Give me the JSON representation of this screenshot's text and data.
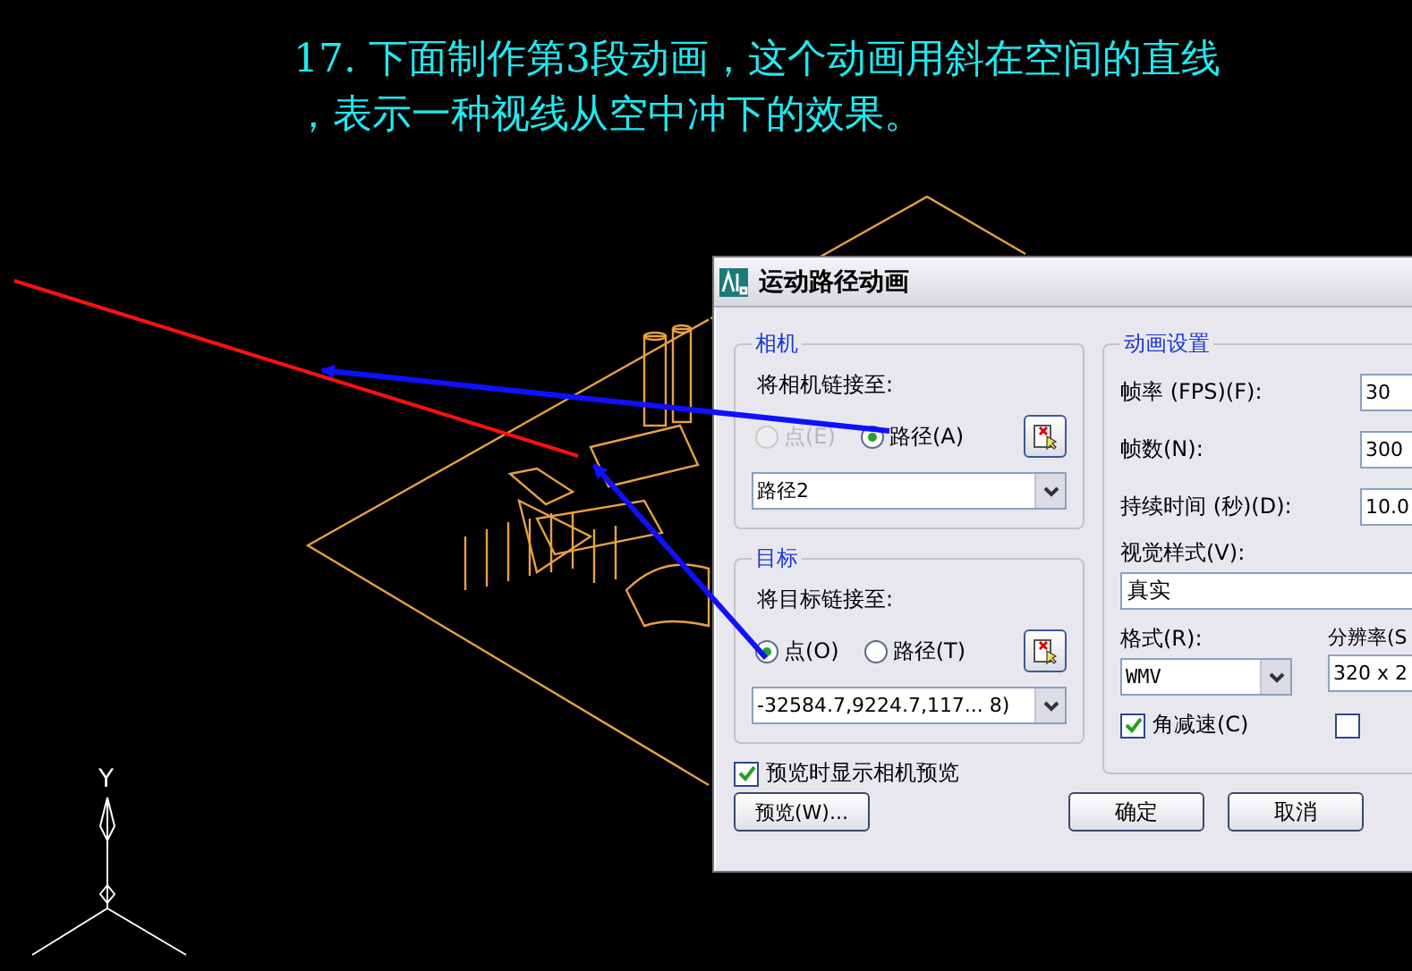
{
  "caption": {
    "lines": [
      "17. 下面制作第3段动画，这个动画用斜在空间的直线",
      "，表示一种视线从空中冲下的效果。"
    ]
  },
  "axis": {
    "label": "Y"
  },
  "dialog": {
    "title": "运动路径动画",
    "camera": {
      "title": "相机",
      "link_label": "将相机链接至:",
      "radios": [
        {
          "label": "点(E)",
          "selected": false,
          "disabled": true
        },
        {
          "label": "路径(A)",
          "selected": true,
          "disabled": false
        }
      ],
      "dropdown": "路径2"
    },
    "target": {
      "title": "目标",
      "link_label": "将目标链接至:",
      "radios": [
        {
          "label": "点(O)",
          "selected": true,
          "disabled": false
        },
        {
          "label": "路径(T)",
          "selected": false,
          "disabled": false
        }
      ],
      "dropdown": "-32584.7,9224.7,117... 8)"
    },
    "show_preview": {
      "label": "预览时显示相机预览",
      "checked": true
    },
    "preview_button": "预览(W)...",
    "settings": {
      "title": "动画设置",
      "fields": [
        {
          "label": "帧率 (FPS)(F):",
          "value": "30"
        },
        {
          "label": "帧数(N):",
          "value": "300"
        },
        {
          "label": "持续时间 (秒)(D):",
          "value": "10.0"
        }
      ],
      "visual_style": {
        "label": "视觉样式(V):",
        "value": "真实"
      },
      "format": {
        "label": "格式(R):",
        "value": "WMV"
      },
      "resolution": {
        "label": "分辨率(S",
        "value": "320 x 2"
      },
      "options": [
        {
          "label": "角减速(C)",
          "checked": true
        },
        {
          "checked": false
        }
      ]
    },
    "buttons": [
      {
        "label": "确定"
      },
      {
        "label": "取消"
      }
    ]
  }
}
